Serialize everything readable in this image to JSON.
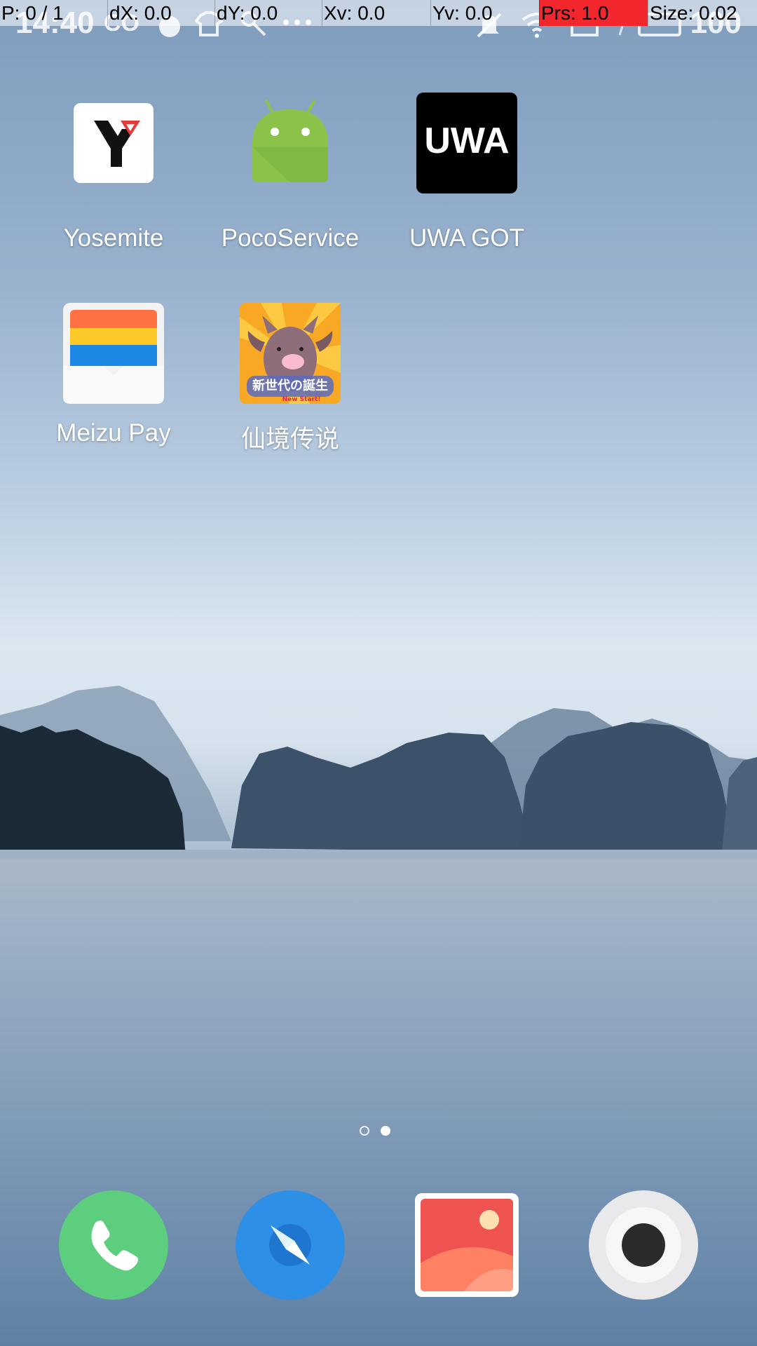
{
  "status_bar": {
    "time": "14:40",
    "battery": "100",
    "carrier_icon": "hd-icon",
    "icons": [
      "notification-icon",
      "tshirt-icon",
      "key-icon",
      "more-icon",
      "mute-icon",
      "wifi-icon",
      "sim-icon",
      "battery-icon"
    ]
  },
  "pointer_overlay": {
    "p": "P: 0 / 1",
    "dx": "dX: 0.0",
    "dy": "dY: 0.0",
    "xv": "Xv: 0.0",
    "yv": "Yv: 0.0",
    "prs": "Prs: 1.0",
    "size": "Size: 0.02",
    "highlight_color": "#f2272e"
  },
  "apps": [
    {
      "name": "Yosemite",
      "icon": "yosemite-icon"
    },
    {
      "name": "PocoService",
      "icon": "android-icon"
    },
    {
      "name": "UWA GOT",
      "icon": "uwa-icon"
    },
    {
      "name": "Meizu Pay",
      "icon": "wallet-icon"
    },
    {
      "name": "仙境传说",
      "icon": "ragnarok-game-icon",
      "icon_text": "新世代の誕生",
      "icon_subtext": "New Start!"
    }
  ],
  "page_indicator": {
    "pages": 2,
    "current": 2
  },
  "dock": [
    {
      "icon": "phone-icon",
      "color": "#5dcd7e"
    },
    {
      "icon": "browser-compass-icon",
      "color": "#2e8fe6"
    },
    {
      "icon": "gallery-icon",
      "color": "#ef5350"
    },
    {
      "icon": "camera-icon",
      "color": "#e9e9ec"
    }
  ],
  "uwa_icon_text": "UWA"
}
